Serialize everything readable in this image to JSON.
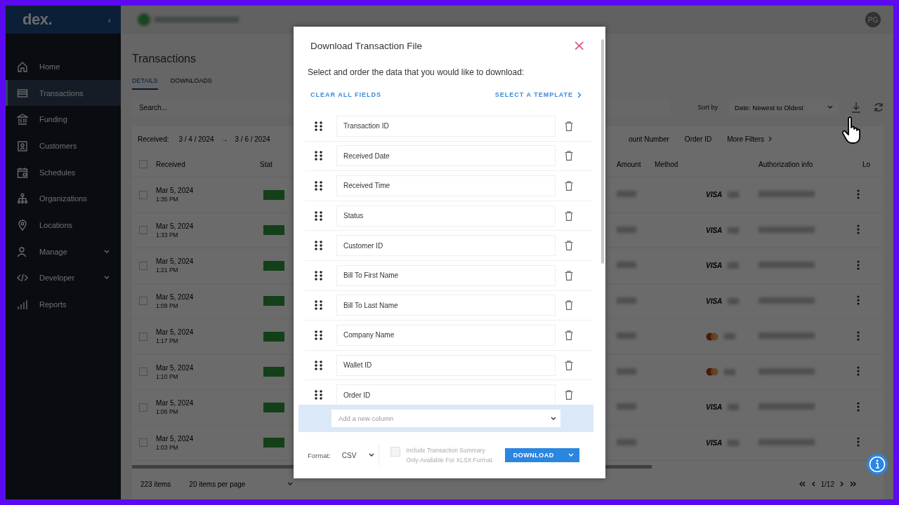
{
  "sidebar": {
    "logo": "dex.",
    "collapse_icon": "‹",
    "items": [
      {
        "label": "Home",
        "kind": "home",
        "selected": false,
        "has_submenu": false
      },
      {
        "label": "Transactions",
        "kind": "card",
        "selected": true,
        "has_submenu": false
      },
      {
        "label": "Funding",
        "kind": "bank",
        "selected": false,
        "has_submenu": false
      },
      {
        "label": "Customers",
        "kind": "people",
        "selected": false,
        "has_submenu": false
      },
      {
        "label": "Schedules",
        "kind": "calendar",
        "selected": false,
        "has_submenu": false
      },
      {
        "label": "Organizations",
        "kind": "org",
        "selected": false,
        "has_submenu": false
      },
      {
        "label": "Locations",
        "kind": "pin",
        "selected": false,
        "has_submenu": false
      },
      {
        "label": "Manage",
        "kind": "user",
        "selected": false,
        "has_submenu": true
      },
      {
        "label": "Developer",
        "kind": "code",
        "selected": false,
        "has_submenu": true
      },
      {
        "label": "Reports",
        "kind": "chart",
        "selected": false,
        "has_submenu": false
      }
    ]
  },
  "header": {
    "avatar": "PG"
  },
  "page": {
    "title": "Transactions",
    "tabs": [
      {
        "label": "DETAILS",
        "selected": true
      },
      {
        "label": "DOWNLOADS",
        "selected": false
      }
    ],
    "search": {
      "placeholder": "Search..."
    },
    "sort": {
      "label": "Sort by",
      "value": "Date: Newest to Oldest"
    },
    "filters": {
      "label": "Received:",
      "from": "3 / 4 / 2024",
      "arrow": "→",
      "to": "3 / 6 / 2024",
      "right": [
        "ount Number",
        "Order ID"
      ],
      "more": "More Filters"
    },
    "table": {
      "columns": [
        "Received",
        "Stat",
        "Amount",
        "Method",
        "Authorization info",
        "Lo"
      ],
      "all_checked": false,
      "rows": [
        {
          "checked": false,
          "date": "Mar 5, 2024",
          "time": "1:35 PM",
          "kind": "visa",
          "card_text": "VISA"
        },
        {
          "checked": false,
          "date": "Mar 5, 2024",
          "time": "1:33 PM",
          "kind": "visa",
          "card_text": "VISA"
        },
        {
          "checked": false,
          "date": "Mar 5, 2024",
          "time": "1:21 PM",
          "kind": "visa",
          "card_text": "VISA"
        },
        {
          "checked": false,
          "date": "Mar 5, 2024",
          "time": "1:09 PM",
          "kind": "visa",
          "card_text": "VISA"
        },
        {
          "checked": false,
          "date": "Mar 5, 2024",
          "time": "1:17 PM",
          "kind": "mastercard"
        },
        {
          "checked": false,
          "date": "Mar 5, 2024",
          "time": "1:10 PM",
          "kind": "mastercard"
        },
        {
          "checked": false,
          "date": "Mar 5, 2024",
          "time": "1:06 PM",
          "kind": "visa",
          "card_text": "VISA"
        },
        {
          "checked": false,
          "date": "Mar 5, 2024",
          "time": "1:03 PM",
          "kind": "visa",
          "card_text": "VISA"
        }
      ]
    },
    "footer": {
      "count": "223 items",
      "per_page": "20 items per page",
      "pages": "1/12"
    }
  },
  "modal": {
    "title": "Download Transaction File",
    "close": "×",
    "subtitle": "Select and order the data that you would like to download:",
    "clear_link": "CLEAR ALL FIELDS",
    "template_link": "SELECT A TEMPLATE",
    "fields": [
      {
        "label": "Transaction ID"
      },
      {
        "label": "Received Date"
      },
      {
        "label": "Received Time"
      },
      {
        "label": "Status"
      },
      {
        "label": "Customer ID"
      },
      {
        "label": "Bill To First Name"
      },
      {
        "label": "Bill To Last Name"
      },
      {
        "label": "Company Name"
      },
      {
        "label": "Wallet ID"
      },
      {
        "label": "Order ID"
      }
    ],
    "add_column": {
      "placeholder": "Add a new column"
    },
    "format": {
      "label": "Format:",
      "value": "CSV"
    },
    "summary": {
      "label": "Include Transaction Summary",
      "note": "Only Available For XLSX Format.",
      "checked": false,
      "disabled": true
    },
    "download": "DOWNLOAD"
  }
}
